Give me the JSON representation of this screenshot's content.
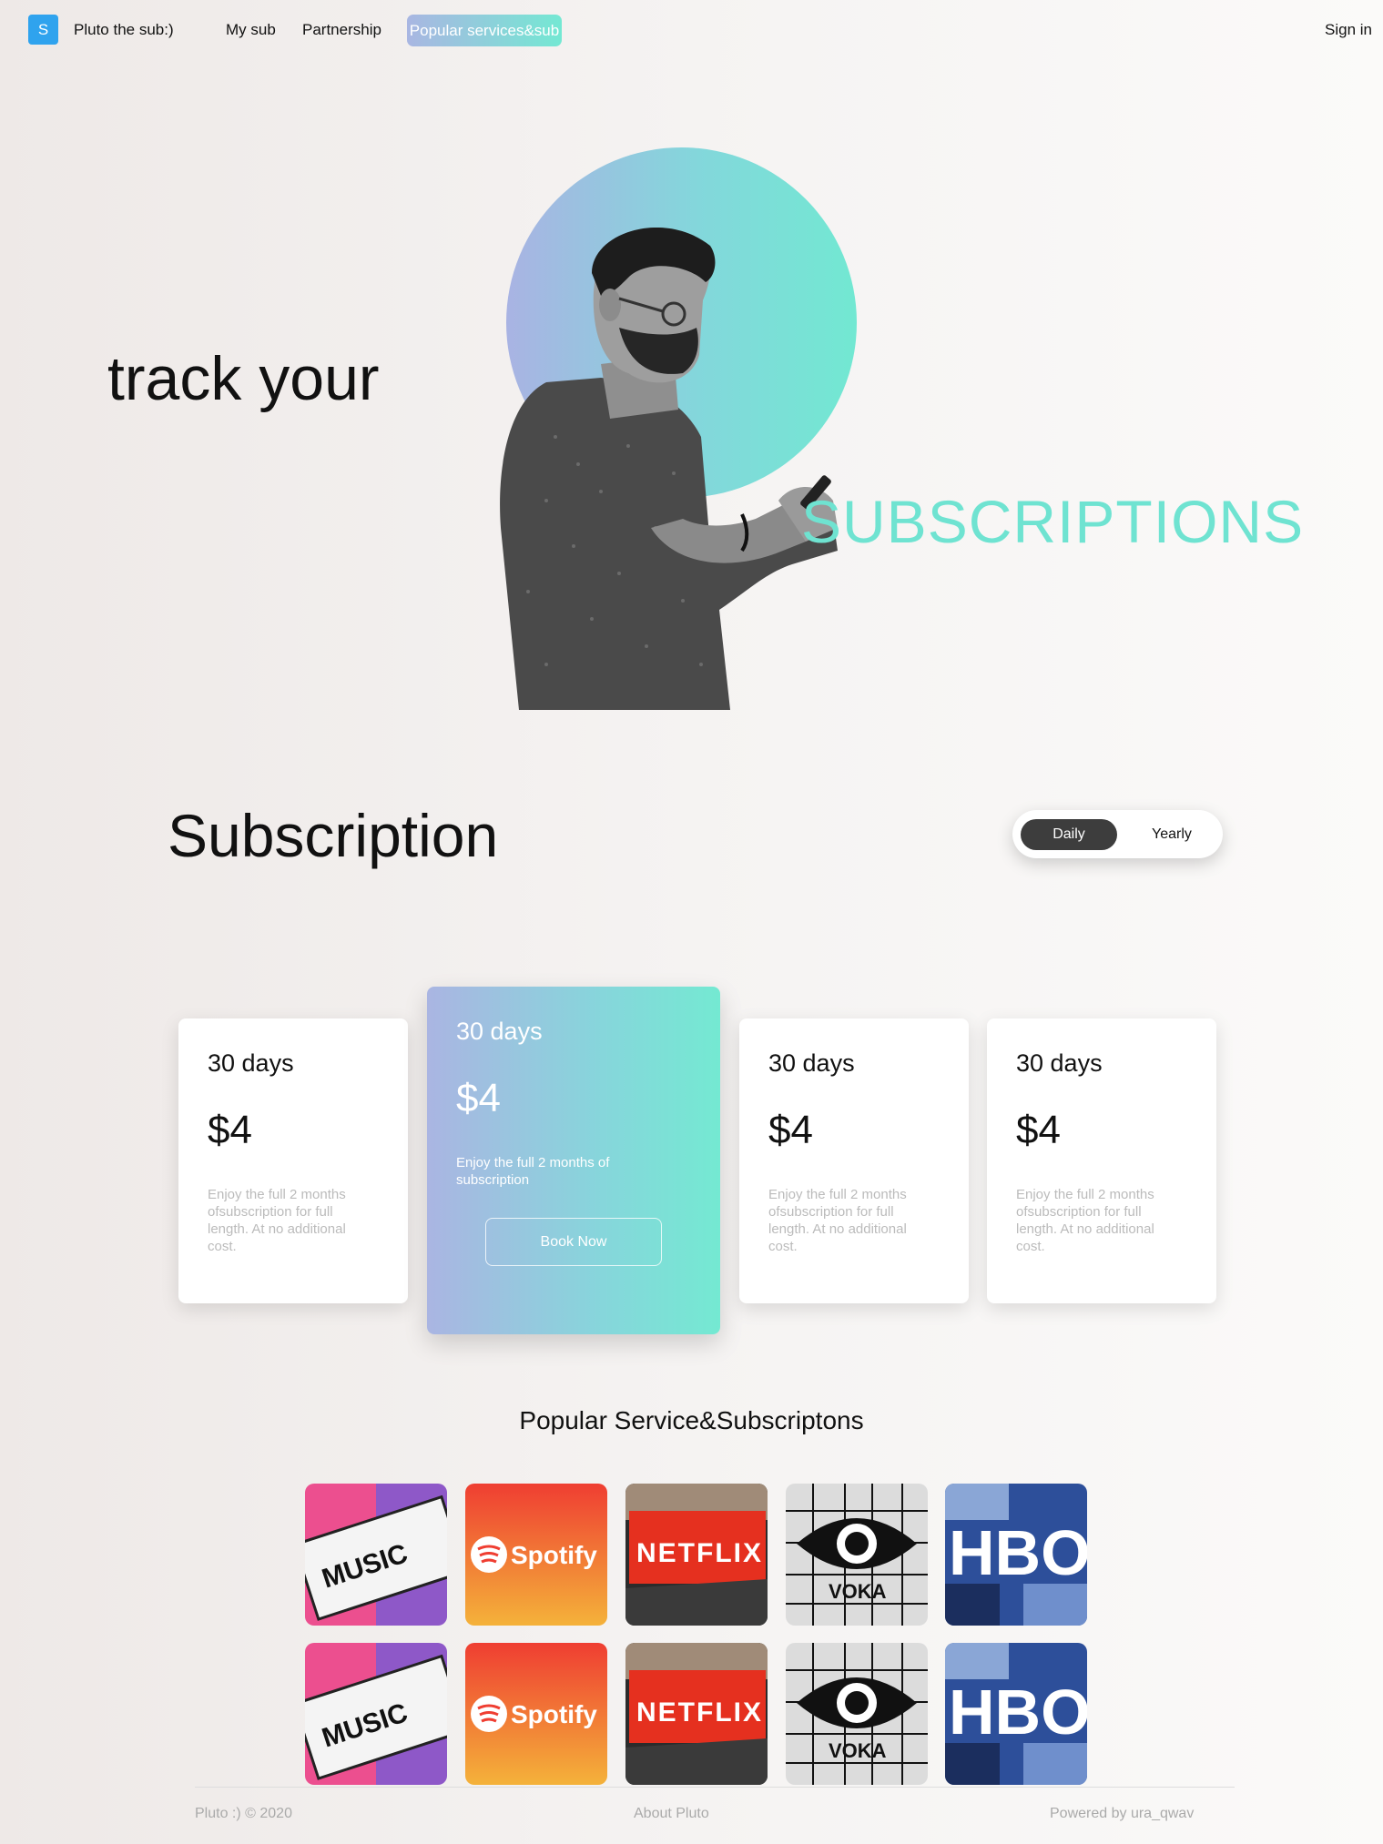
{
  "nav": {
    "logo_letter": "S",
    "brand": "Pluto the sub:)",
    "links": [
      "My sub",
      "Partnership"
    ],
    "active_link": "Popular services&sub",
    "signin": "Sign in"
  },
  "hero": {
    "line1": "track your",
    "line2": "SUBSCRIPTIONS"
  },
  "subscription": {
    "title": "Subscription",
    "toggle": {
      "daily": "Daily",
      "yearly": "Yearly",
      "selected": "Daily"
    },
    "cards": [
      {
        "days": "30 days",
        "price": "$4",
        "desc": "Enjoy the full 2 months ofsubscription for full length. At no additional cost."
      },
      {
        "days": "30 days",
        "price": "$4",
        "desc": "Enjoy the full 2 months of subscription",
        "button": "Book Now"
      },
      {
        "days": "30 days",
        "price": "$4",
        "desc": "Enjoy the full 2 months ofsubscription for full length. At no additional cost."
      },
      {
        "days": "30 days",
        "price": "$4",
        "desc": "Enjoy the full 2 months ofsubscription for full length. At no additional cost."
      }
    ]
  },
  "popular": {
    "title": "Popular Service&Subscriptons",
    "services": [
      {
        "name": "apple-music",
        "text": "MUSIC"
      },
      {
        "name": "spotify",
        "text": "Spotify"
      },
      {
        "name": "netflix",
        "text": "NETFLIX"
      },
      {
        "name": "voka",
        "text": "VOKA"
      },
      {
        "name": "hbo",
        "text": "HBO"
      }
    ]
  },
  "footer": {
    "copyright": "Pluto :) © 2020",
    "about": "About Pluto",
    "powered": "Powered by ura_qwav"
  },
  "colors": {
    "accent_start": "#a9b6e2",
    "accent_end": "#74e8d3",
    "logo": "#2fa3ee"
  }
}
